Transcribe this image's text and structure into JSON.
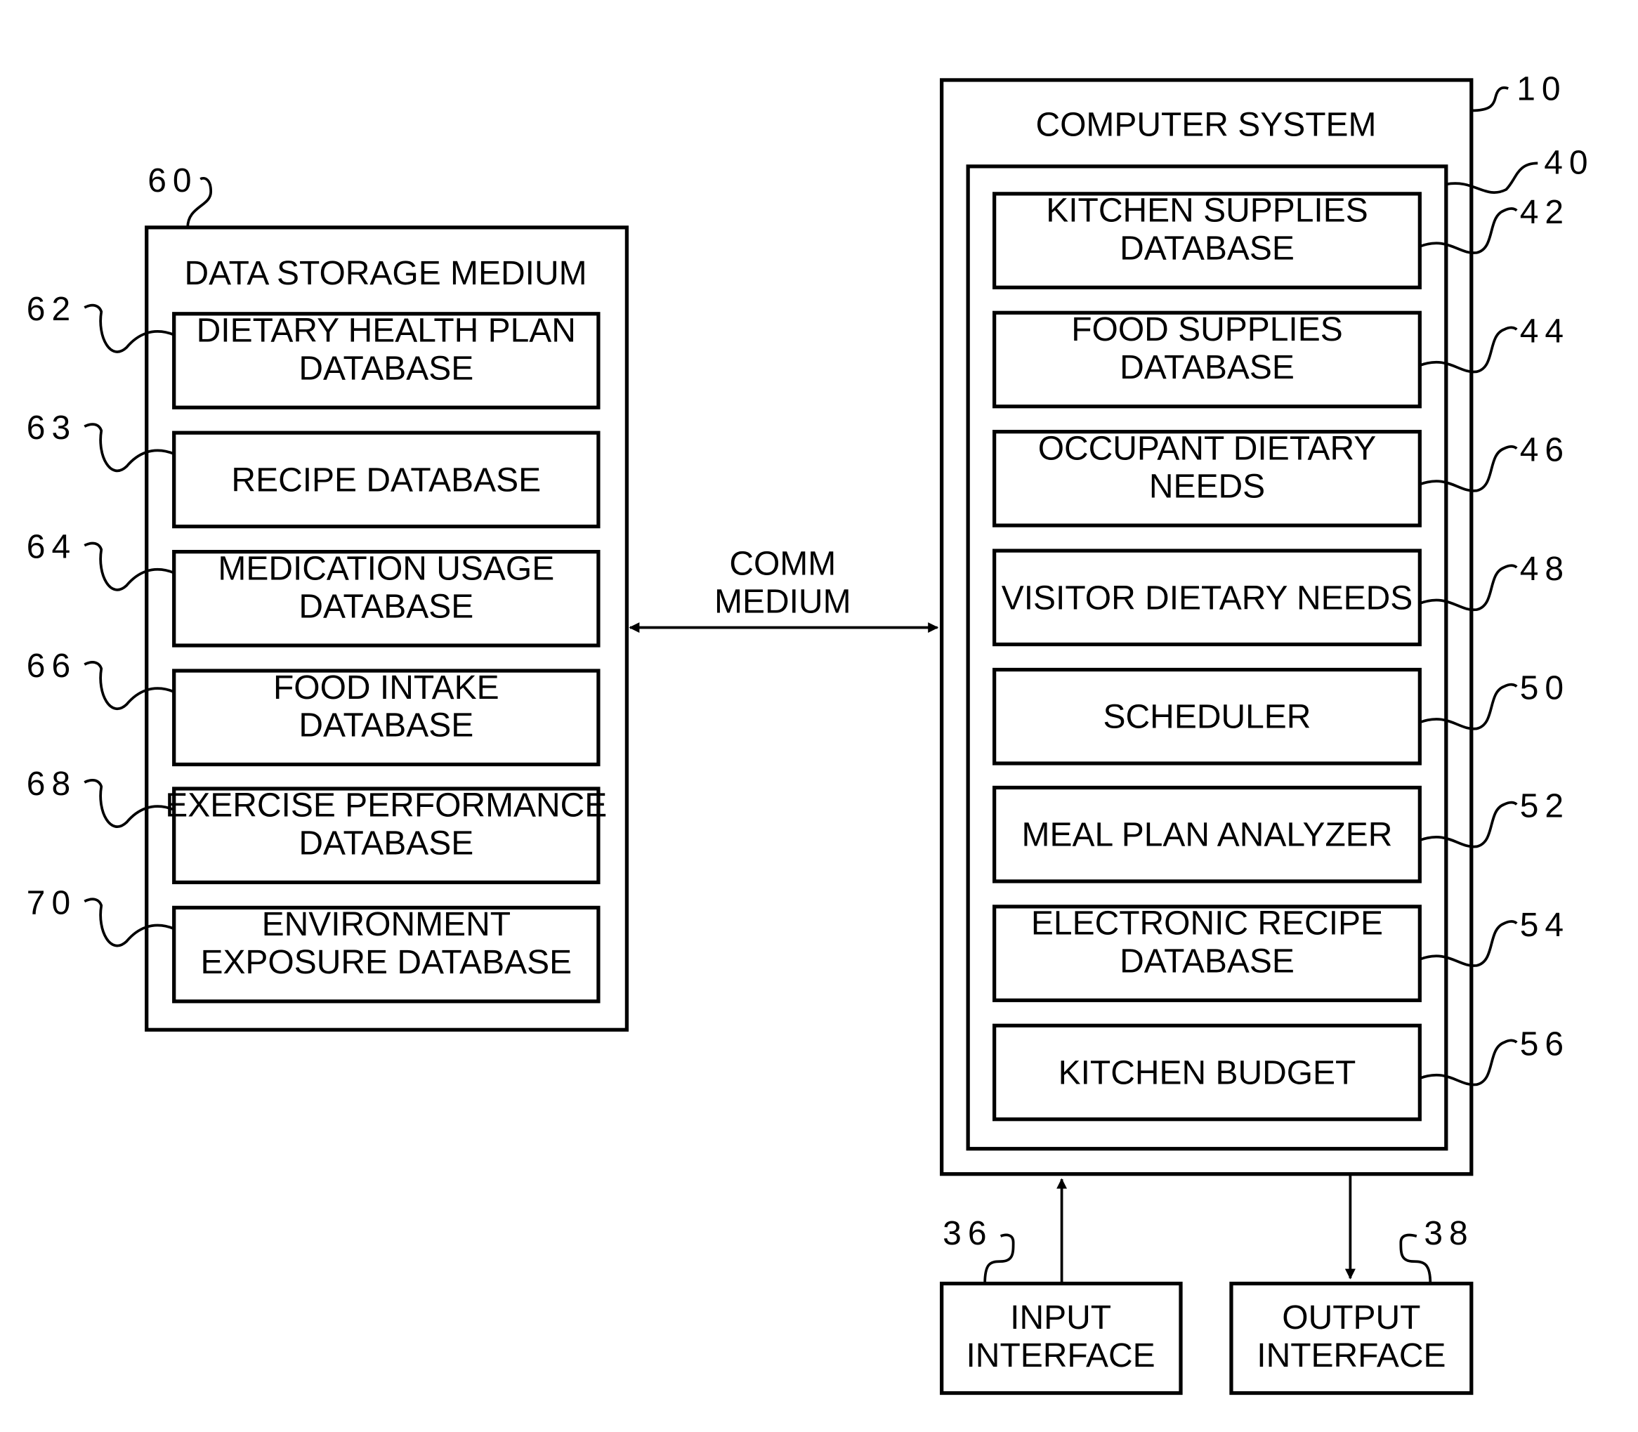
{
  "data_storage": {
    "ref": "60",
    "title": "DATA STORAGE MEDIUM",
    "items": [
      {
        "ref": "62",
        "lines": [
          "DIETARY HEALTH PLAN",
          "DATABASE"
        ]
      },
      {
        "ref": "63",
        "lines": [
          "RECIPE DATABASE"
        ]
      },
      {
        "ref": "64",
        "lines": [
          "MEDICATION USAGE",
          "DATABASE"
        ]
      },
      {
        "ref": "66",
        "lines": [
          "FOOD INTAKE",
          "DATABASE"
        ]
      },
      {
        "ref": "68",
        "lines": [
          "EXERCISE PERFORMANCE",
          "DATABASE"
        ]
      },
      {
        "ref": "70",
        "lines": [
          "ENVIRONMENT",
          "EXPOSURE DATABASE"
        ]
      }
    ]
  },
  "comm": {
    "lines": [
      "COMM",
      "MEDIUM"
    ]
  },
  "computer_system": {
    "ref": "10",
    "title": "COMPUTER SYSTEM",
    "inner_ref": "40",
    "items": [
      {
        "ref": "42",
        "lines": [
          "KITCHEN SUPPLIES",
          "DATABASE"
        ]
      },
      {
        "ref": "44",
        "lines": [
          "FOOD SUPPLIES",
          "DATABASE"
        ]
      },
      {
        "ref": "46",
        "lines": [
          "OCCUPANT DIETARY",
          "NEEDS"
        ]
      },
      {
        "ref": "48",
        "lines": [
          "VISITOR DIETARY NEEDS"
        ]
      },
      {
        "ref": "50",
        "lines": [
          "SCHEDULER"
        ]
      },
      {
        "ref": "52",
        "lines": [
          "MEAL PLAN ANALYZER"
        ]
      },
      {
        "ref": "54",
        "lines": [
          "ELECTRONIC RECIPE",
          "DATABASE"
        ]
      },
      {
        "ref": "56",
        "lines": [
          "KITCHEN BUDGET"
        ]
      }
    ]
  },
  "input_interface": {
    "ref": "36",
    "lines": [
      "INPUT",
      "INTERFACE"
    ]
  },
  "output_interface": {
    "ref": "38",
    "lines": [
      "OUTPUT",
      "INTERFACE"
    ]
  }
}
